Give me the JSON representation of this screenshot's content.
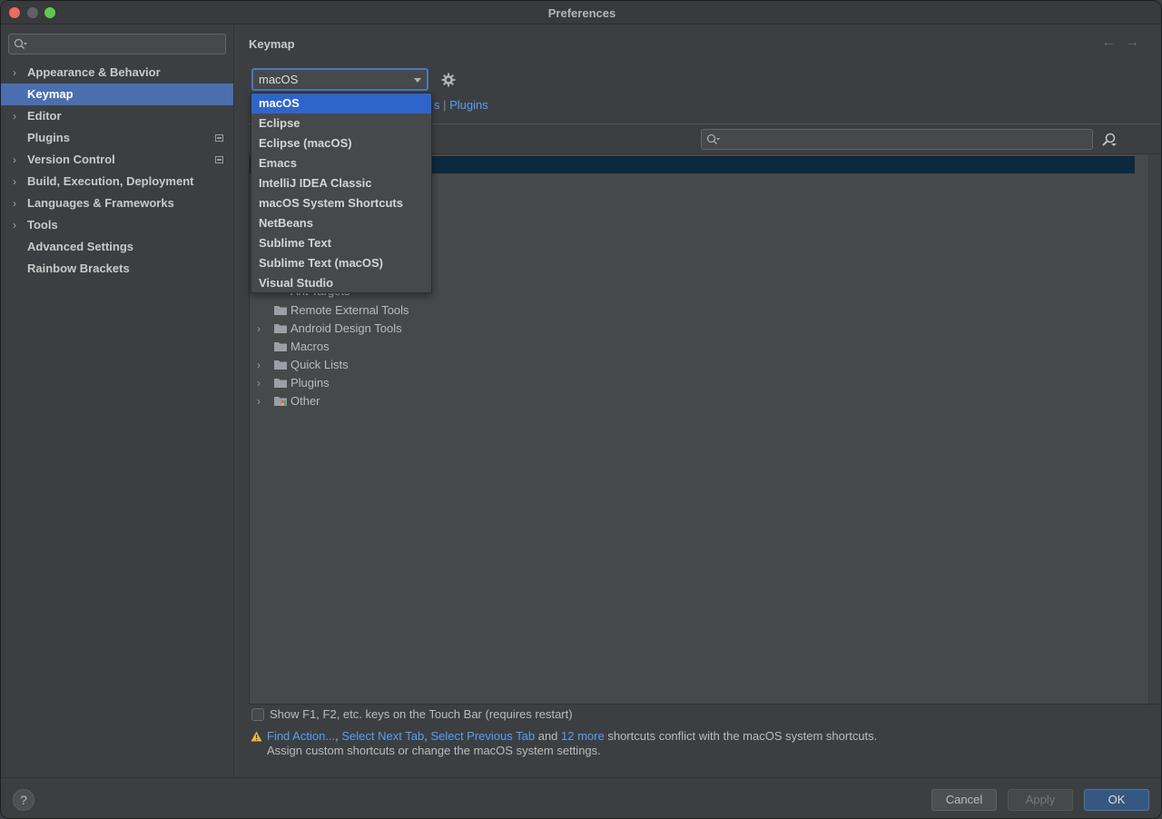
{
  "window": {
    "title": "Preferences"
  },
  "sidebar": {
    "search_placeholder": "",
    "items": [
      {
        "label": "Appearance & Behavior",
        "expandable": true,
        "selected": false,
        "badge": false
      },
      {
        "label": "Keymap",
        "expandable": false,
        "selected": true,
        "badge": false
      },
      {
        "label": "Editor",
        "expandable": true,
        "selected": false,
        "badge": false
      },
      {
        "label": "Plugins",
        "expandable": false,
        "selected": false,
        "badge": true
      },
      {
        "label": "Version Control",
        "expandable": true,
        "selected": false,
        "badge": true
      },
      {
        "label": "Build, Execution, Deployment",
        "expandable": true,
        "selected": false,
        "badge": false
      },
      {
        "label": "Languages & Frameworks",
        "expandable": true,
        "selected": false,
        "badge": false
      },
      {
        "label": "Tools",
        "expandable": true,
        "selected": false,
        "badge": false
      },
      {
        "label": "Advanced Settings",
        "expandable": false,
        "selected": false,
        "badge": false
      },
      {
        "label": "Rainbow Brackets",
        "expandable": false,
        "selected": false,
        "badge": false
      }
    ]
  },
  "main": {
    "title": "Keymap",
    "back_arrow": "←",
    "forward_arrow": "→",
    "keymap_select": {
      "value": "macOS"
    },
    "tabs_partial": "s",
    "tabs_sep": " | ",
    "tabs_plugins": "Plugins",
    "dropdown": {
      "options": [
        "macOS",
        "Eclipse",
        "Eclipse (macOS)",
        "Emacs",
        "IntelliJ IDEA Classic",
        "macOS System Shortcuts",
        "NetBeans",
        "Sublime Text",
        "Sublime Text (macOS)",
        "Visual Studio"
      ],
      "selected_index": 0
    },
    "tree": {
      "rows": [
        {
          "label": "Remote External Tools",
          "expandable": false,
          "icon": "folder-icon"
        },
        {
          "label": "Android Design Tools",
          "expandable": true,
          "icon": "folder-icon"
        },
        {
          "label": "Macros",
          "expandable": false,
          "icon": "folder-icon"
        },
        {
          "label": "Quick Lists",
          "expandable": true,
          "icon": "folder-icon"
        },
        {
          "label": "Plugins",
          "expandable": true,
          "icon": "folder-icon"
        },
        {
          "label": "Other",
          "expandable": true,
          "icon": "folder-other-icon"
        }
      ],
      "partial_row": "Ant Targets"
    },
    "touchbar_label": "Show F1, F2, etc. keys on the Touch Bar (requires restart)",
    "warning": {
      "link_find_action": "Find Action...",
      "comma1": ", ",
      "link_next_tab": "Select Next Tab",
      "comma2": ", ",
      "link_prev_tab": "Select Previous Tab",
      "and": " and ",
      "link_more": "12 more",
      "rest": " shortcuts conflict with the macOS system shortcuts.",
      "line2": "Assign custom shortcuts or change the macOS system settings."
    }
  },
  "footer": {
    "help_label": "?",
    "cancel_label": "Cancel",
    "apply_label": "Apply",
    "ok_label": "OK"
  },
  "colors": {
    "accent": "#4b6eaf",
    "link": "#589df6",
    "background": "#3c3f41",
    "dropdown_selected": "#2f65ca"
  }
}
